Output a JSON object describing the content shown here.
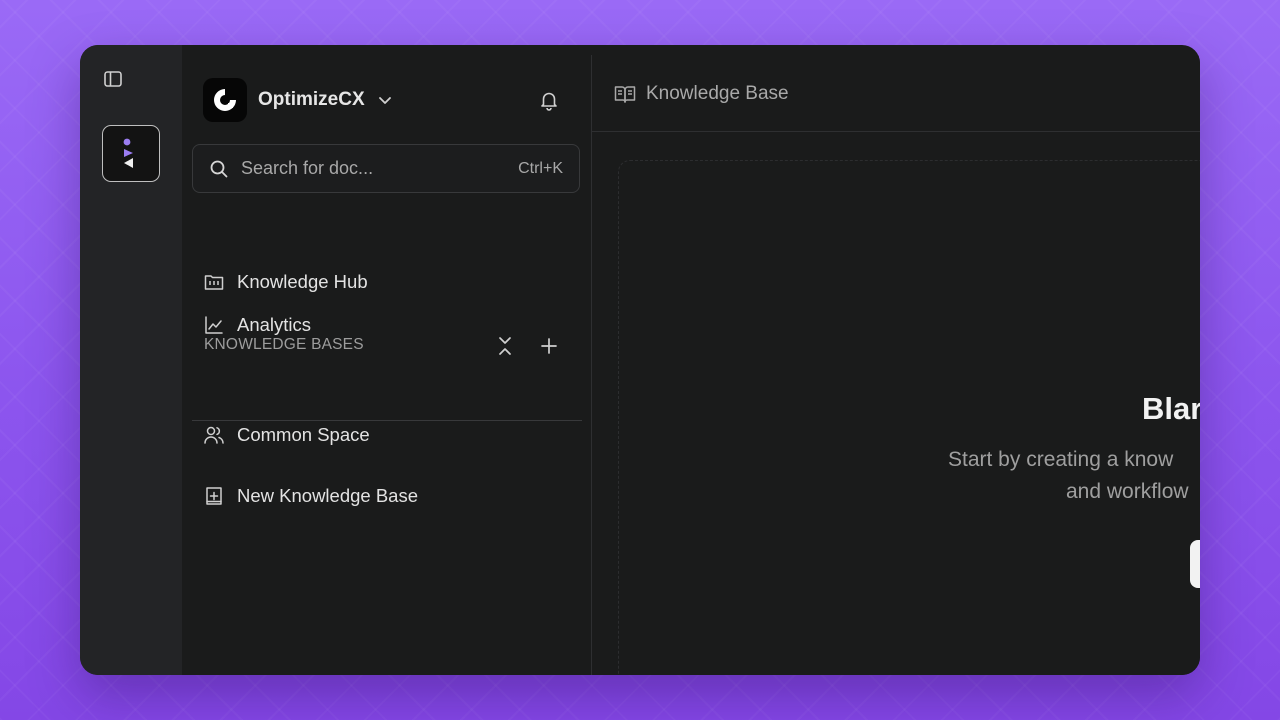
{
  "sidebar": {
    "org_name": "OptimizeCX",
    "search": {
      "placeholder": "Search for doc...",
      "shortcut": "Ctrl+K"
    },
    "nav": [
      {
        "label": "Knowledge Hub",
        "icon": "knowledge-hub-icon"
      },
      {
        "label": "Analytics",
        "icon": "chart-line-icon"
      }
    ],
    "section_title": "KNOWLEDGE BASES",
    "knowledge_bases": [
      {
        "label": "Common Space",
        "icon": "users-icon"
      }
    ],
    "new_kb_label": "New Knowledge Base"
  },
  "main": {
    "breadcrumb": "Knowledge Base",
    "empty_state": {
      "title": "Blar",
      "desc_line1": "Start by creating a know",
      "desc_line2": "and workflow"
    }
  },
  "colors": {
    "background": "#8c55ee",
    "window": "#1a1b1b",
    "rail": "#232426",
    "accent_logo": "#9b7df2"
  }
}
